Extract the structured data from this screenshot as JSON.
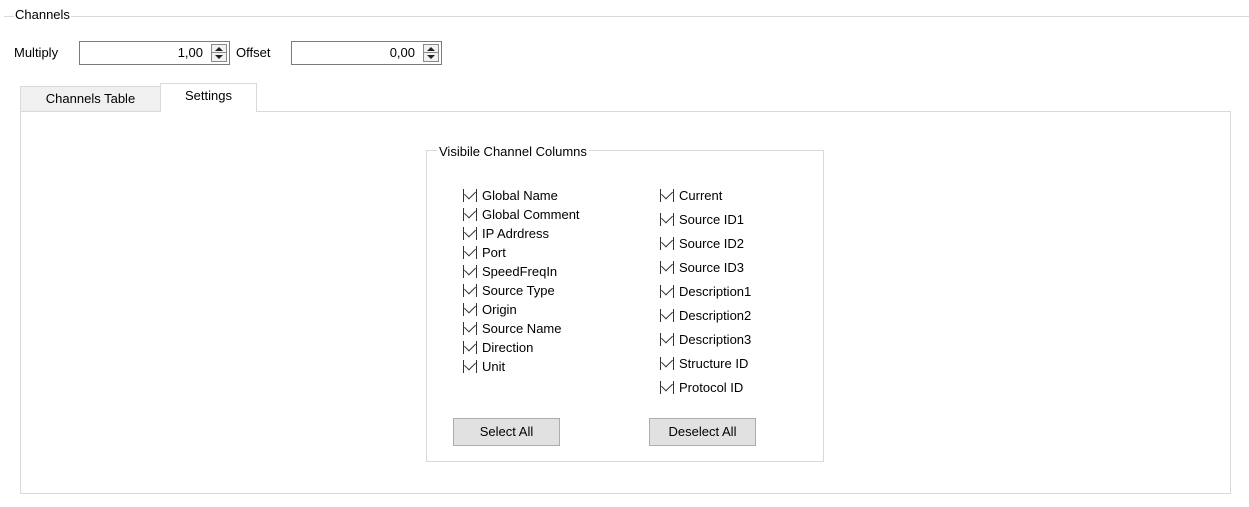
{
  "group": {
    "title": "Channels"
  },
  "multiply": {
    "label": "Multiply",
    "value": "1,00"
  },
  "offset": {
    "label": "Offset",
    "value": "0,00"
  },
  "tabs": [
    {
      "label": "Channels Table",
      "active": false
    },
    {
      "label": "Settings",
      "active": true
    }
  ],
  "settings": {
    "group_title": "Visibile Channel Columns",
    "left_columns": [
      {
        "label": "Global Name",
        "checked": true
      },
      {
        "label": "Global Comment",
        "checked": true
      },
      {
        "label": "IP Adrdress",
        "checked": true
      },
      {
        "label": "Port",
        "checked": true
      },
      {
        "label": "SpeedFreqIn",
        "checked": true
      },
      {
        "label": "Source Type",
        "checked": true
      },
      {
        "label": "Origin",
        "checked": true
      },
      {
        "label": "Source Name",
        "checked": true
      },
      {
        "label": "Direction",
        "checked": true
      },
      {
        "label": "Unit",
        "checked": true
      }
    ],
    "right_columns": [
      {
        "label": "Current",
        "checked": true
      },
      {
        "label": "Source ID1",
        "checked": true
      },
      {
        "label": "Source ID2",
        "checked": true
      },
      {
        "label": "Source ID3",
        "checked": true
      },
      {
        "label": "Description1",
        "checked": true
      },
      {
        "label": "Description2",
        "checked": true
      },
      {
        "label": "Description3",
        "checked": true
      },
      {
        "label": "Structure ID",
        "checked": true
      },
      {
        "label": "Protocol ID",
        "checked": true
      }
    ],
    "select_all_label": "Select All",
    "deselect_all_label": "Deselect All"
  }
}
